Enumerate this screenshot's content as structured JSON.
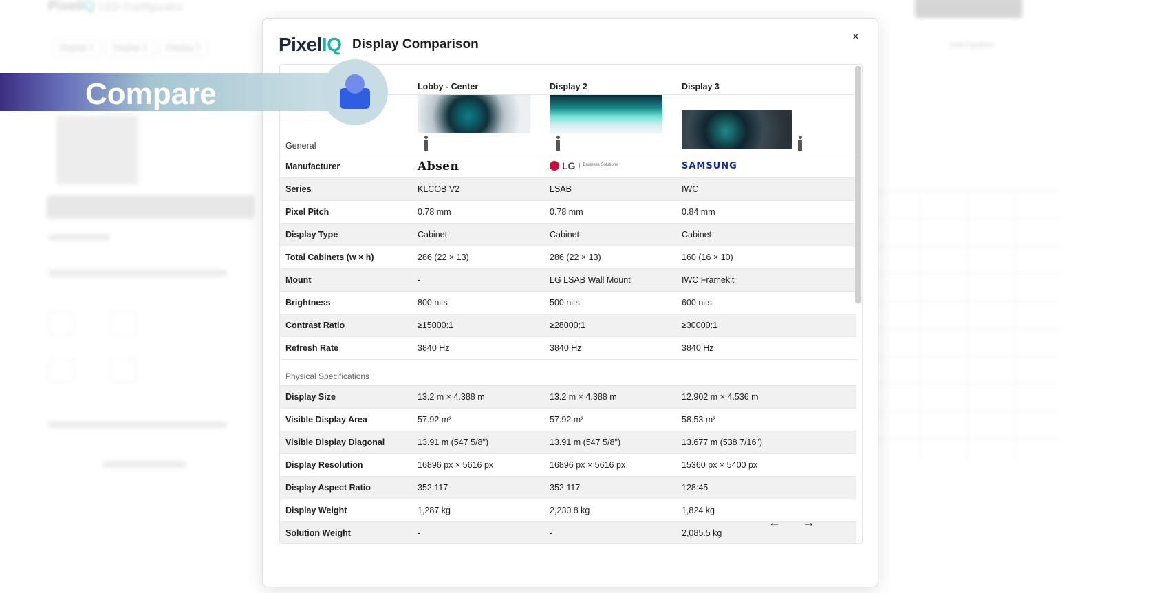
{
  "background": {
    "app_title_part1": "Pixel",
    "app_title_part2": "IQ",
    "app_title_suffix": "LED Configurator",
    "tabs": [
      "Display 1",
      "Display 2",
      "Display 3"
    ],
    "unit_label": "Unit System"
  },
  "banner": {
    "text": "Compare"
  },
  "modal": {
    "logo_part1": "Pixel",
    "logo_part2": "IQ",
    "title": "Display Comparison",
    "close_symbol": "×",
    "columns": [
      "Lobby - Center",
      "Display 2",
      "Display 3"
    ],
    "general_label": "General",
    "images": [
      "abstract-sculpture-image",
      "aurora-landscape-image",
      "abstract-sculpture-dark-image"
    ],
    "manufacturer_label": "Manufacturer",
    "manufacturers": {
      "c1": "Absen",
      "c2_logo": "LG",
      "c2_sub": "Business Solutions",
      "c3": "SAMSUNG"
    },
    "general_rows": [
      {
        "label": "Series",
        "values": [
          "KLCOB V2",
          "LSAB",
          "IWC"
        ]
      },
      {
        "label": "Pixel Pitch",
        "values": [
          "0.78 mm",
          "0.78 mm",
          "0.84 mm"
        ]
      },
      {
        "label": "Display Type",
        "values": [
          "Cabinet",
          "Cabinet",
          "Cabinet"
        ]
      },
      {
        "label": "Total Cabinets (w × h)",
        "values": [
          "286 (22 × 13)",
          "286 (22 × 13)",
          "160 (16 × 10)"
        ]
      },
      {
        "label": "Mount",
        "values": [
          "-",
          "LG LSAB Wall Mount",
          "IWC Framekit"
        ]
      },
      {
        "label": "Brightness",
        "values": [
          "800 nits",
          "500 nits",
          "600 nits"
        ]
      },
      {
        "label": "Contrast Ratio",
        "values": [
          "≥15000:1",
          "≥28000:1",
          "≥30000:1"
        ]
      },
      {
        "label": "Refresh Rate",
        "values": [
          "3840 Hz",
          "3840 Hz",
          "3840 Hz"
        ]
      }
    ],
    "physical_section_label": "Physical Specifications",
    "physical_rows": [
      {
        "label": "Display Size",
        "values": [
          "13.2 m × 4.388 m",
          "13.2 m × 4.388 m",
          "12.902 m × 4.536 m"
        ]
      },
      {
        "label": "Visible Display Area",
        "values": [
          "57.92 m²",
          "57.92 m²",
          "58.53 m²"
        ]
      },
      {
        "label": "Visible Display Diagonal",
        "values": [
          "13.91 m (547 5/8\")",
          "13.91 m (547 5/8\")",
          "13.677 m (538 7/16\")"
        ]
      },
      {
        "label": "Display Resolution",
        "values": [
          "16896 px × 5616 px",
          "16896 px × 5616 px",
          "15360 px × 5400 px"
        ]
      },
      {
        "label": "Display Aspect Ratio",
        "values": [
          "352:117",
          "352:117",
          "128:45"
        ]
      },
      {
        "label": "Display Weight",
        "values": [
          "1,287 kg",
          "2,230.8 kg",
          "1,824 kg"
        ]
      },
      {
        "label": "Solution Weight",
        "values": [
          "-",
          "-",
          "2,085.5 kg"
        ]
      }
    ],
    "nav_prev": "←",
    "nav_next": "→"
  }
}
